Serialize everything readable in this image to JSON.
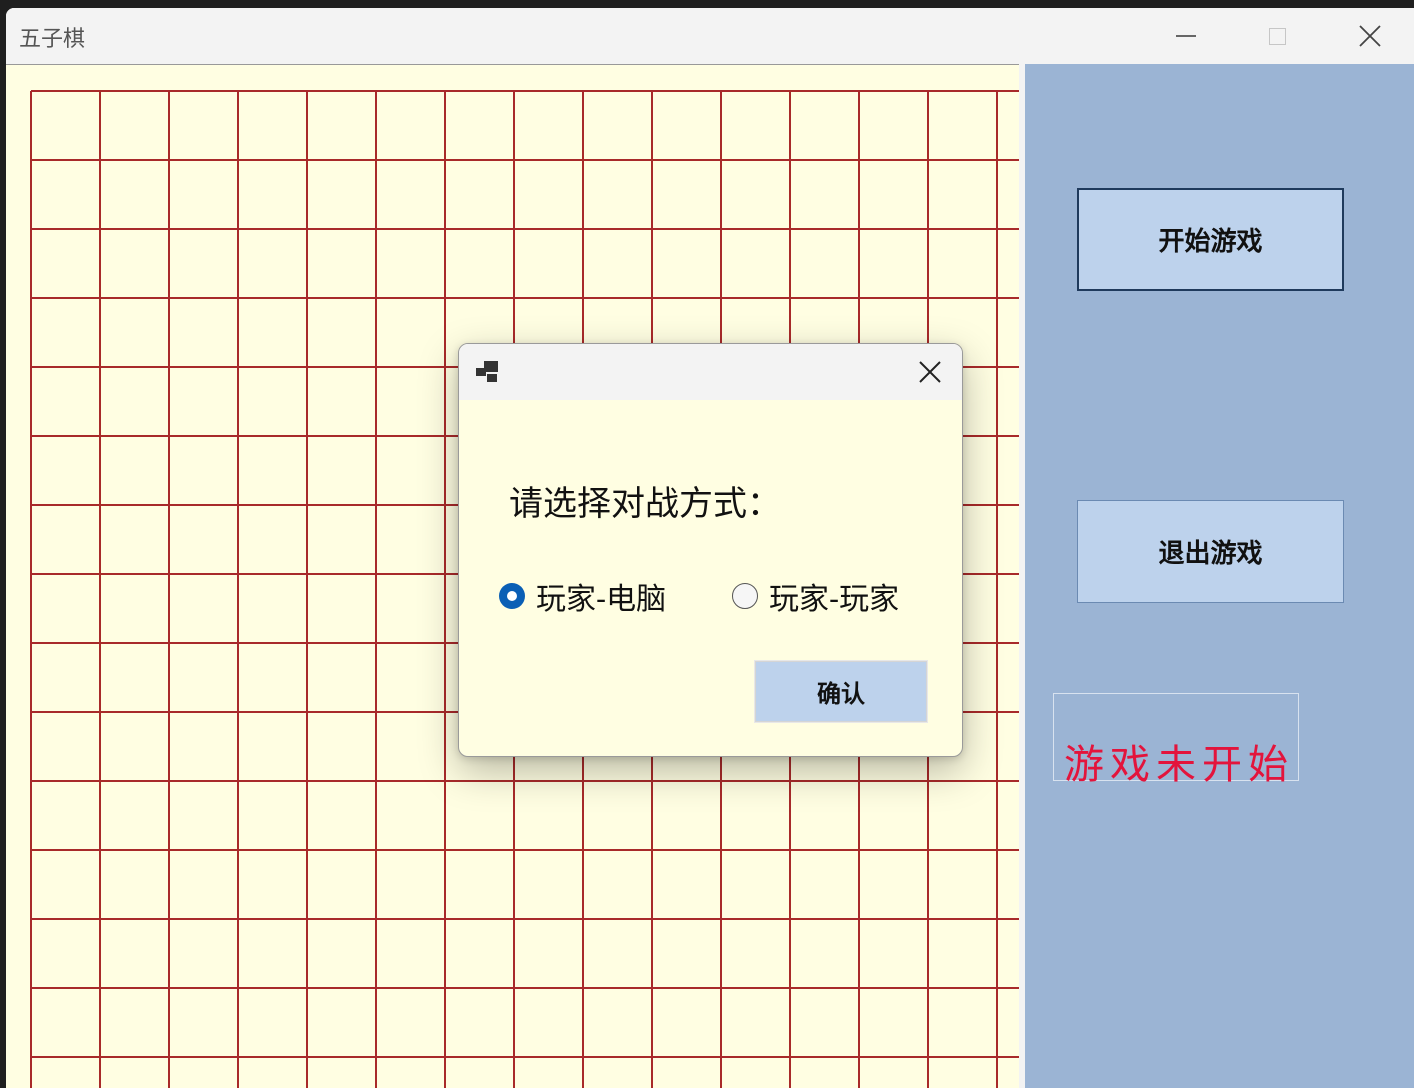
{
  "window": {
    "title": "五子棋",
    "controls": [
      "minimize",
      "maximize",
      "close"
    ]
  },
  "board": {
    "columns": 15,
    "rows": 15,
    "line_color": "#a82a2a",
    "background": "#fffee2"
  },
  "side_panel": {
    "background": "#9bb4d4",
    "start_button": "开始游戏",
    "exit_button": "退出游戏",
    "status": "游戏未开始",
    "status_color": "#e3143c"
  },
  "dialog": {
    "icon": "app-window-icon",
    "prompt": "请选择对战方式：",
    "options": [
      {
        "label": "玩家-电脑",
        "checked": true
      },
      {
        "label": "玩家-玩家",
        "checked": false
      }
    ],
    "confirm_button": "确认",
    "accent_color": "#0a5fb5"
  }
}
